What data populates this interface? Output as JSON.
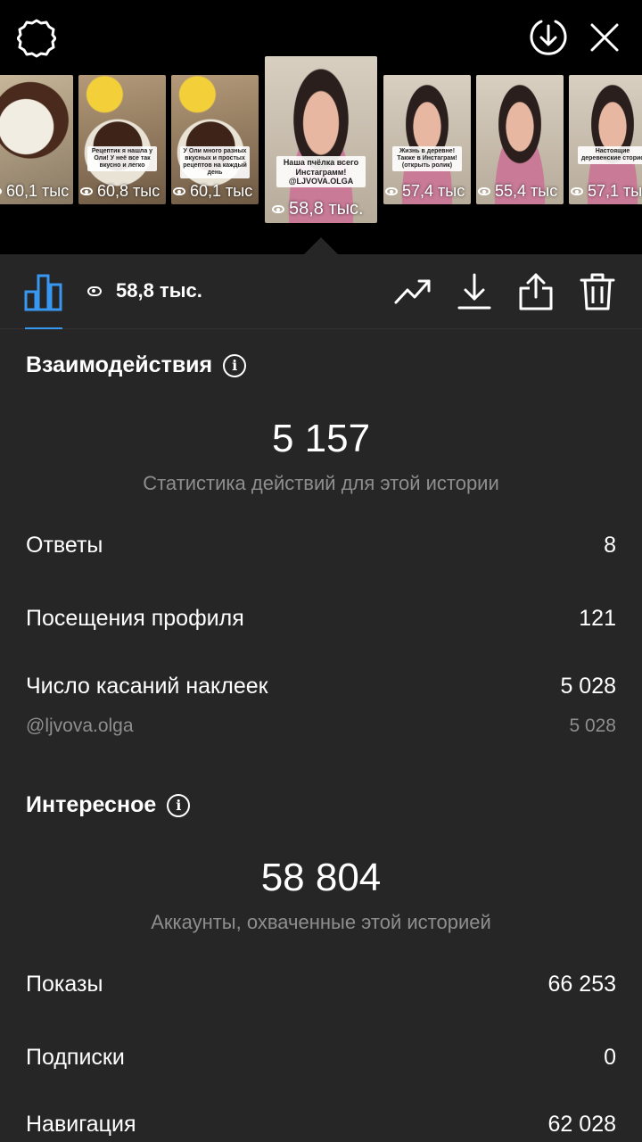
{
  "header": {
    "settings_icon": "gear-icon",
    "save_icon": "download-circle-icon",
    "close_icon": "close-icon"
  },
  "stories": [
    {
      "views": "60,1 тыс",
      "kind": "cake"
    },
    {
      "views": "60,8 тыс",
      "kind": "cake2",
      "caption": "Рецептик я нашла у Оли! У неё все так вкусно и легко"
    },
    {
      "views": "60,1 тыс",
      "kind": "cake2",
      "caption": "У Оли много разных вкусных и простых рецептов на каждый день"
    },
    {
      "views": "58,8 тыс.",
      "kind": "girl",
      "caption": "Наша пчёлка всего Инстаграмм! @LJVOVA.OLGA",
      "active": true
    },
    {
      "views": "57,4 тыс",
      "kind": "girl",
      "caption": "Жизнь в деревне! Также в Инстаграм! (открыть ролик)"
    },
    {
      "views": "55,4 тыс",
      "kind": "girl"
    },
    {
      "views": "57,1 тыс",
      "kind": "girl",
      "caption": "Настоящие деревенские сторис"
    }
  ],
  "toolbar": {
    "views": "58,8 тыс.",
    "icons": [
      "bar-chart-icon",
      "eye-icon",
      "trend-icon",
      "download-icon",
      "share-icon",
      "trash-icon"
    ],
    "accent": "#3897f0"
  },
  "interactions": {
    "title": "Взаимодействия",
    "total": "5 157",
    "caption": "Статистика действий для этой истории",
    "rows": [
      {
        "label": "Ответы",
        "value": "8"
      },
      {
        "label": "Посещения профиля",
        "value": "121"
      },
      {
        "label": "Число касаний наклеек",
        "value": "5 028"
      }
    ],
    "sub_row": {
      "label": "@ljvova.olga",
      "value": "5 028"
    }
  },
  "discovery": {
    "title": "Интересное",
    "total": "58 804",
    "caption": "Аккаунты, охваченные этой историей",
    "rows": [
      {
        "label": "Показы",
        "value": "66 253"
      },
      {
        "label": "Подписки",
        "value": "0"
      },
      {
        "label": "Навигация",
        "value": "62 028"
      }
    ]
  }
}
